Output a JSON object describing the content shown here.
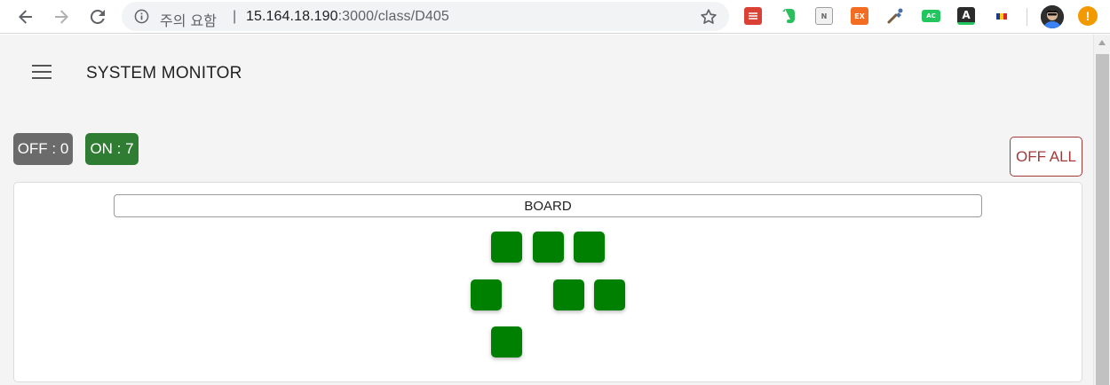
{
  "browser": {
    "warning_label": "주의 요함",
    "separator": "|",
    "url_host": "15.164.18.190",
    "url_path": ":3000/class/D405",
    "extensions": [
      {
        "name": "todoist-extension-icon",
        "label": "",
        "color": "#db4035"
      },
      {
        "name": "evernote-extension-icon",
        "label": "",
        "color": "#2dbe60"
      },
      {
        "name": "reader-extension-icon",
        "label": "N",
        "color": "#9e9e9e"
      },
      {
        "name": "ex-extension-icon",
        "label": "EX",
        "color": "#f36c21"
      },
      {
        "name": "eyedropper-extension-icon",
        "label": "",
        "color": "#4a6fa5"
      },
      {
        "name": "ac-extension-icon",
        "label": "AC",
        "color": "#22c55e"
      },
      {
        "name": "font-extension-icon",
        "label": "A",
        "color": "#2b2b2b"
      },
      {
        "name": "flag-extension-icon",
        "label": "",
        "color": "#ffffff"
      }
    ],
    "alert_label": "!"
  },
  "app": {
    "title": "SYSTEM MONITOR"
  },
  "status": {
    "off_label": "OFF : 0",
    "on_label": "ON : 7",
    "off_count": 0,
    "on_count": 7
  },
  "controls": {
    "off_all_label": "OFF ALL"
  },
  "board": {
    "label": "BOARD",
    "seats": [
      {
        "row": 1,
        "col": 2,
        "state": "on"
      },
      {
        "row": 1,
        "col": 3,
        "state": "on"
      },
      {
        "row": 1,
        "col": 4,
        "state": "on"
      },
      {
        "row": 2,
        "col": 1,
        "state": "on"
      },
      {
        "row": 2,
        "col": 4,
        "state": "on"
      },
      {
        "row": 2,
        "col": 5,
        "state": "on"
      },
      {
        "row": 3,
        "col": 2,
        "state": "on"
      }
    ]
  },
  "colors": {
    "seat_on": "#008000",
    "badge_on": "#2e7d32",
    "badge_off": "#6b6b6b",
    "off_all": "#a33a3a"
  }
}
